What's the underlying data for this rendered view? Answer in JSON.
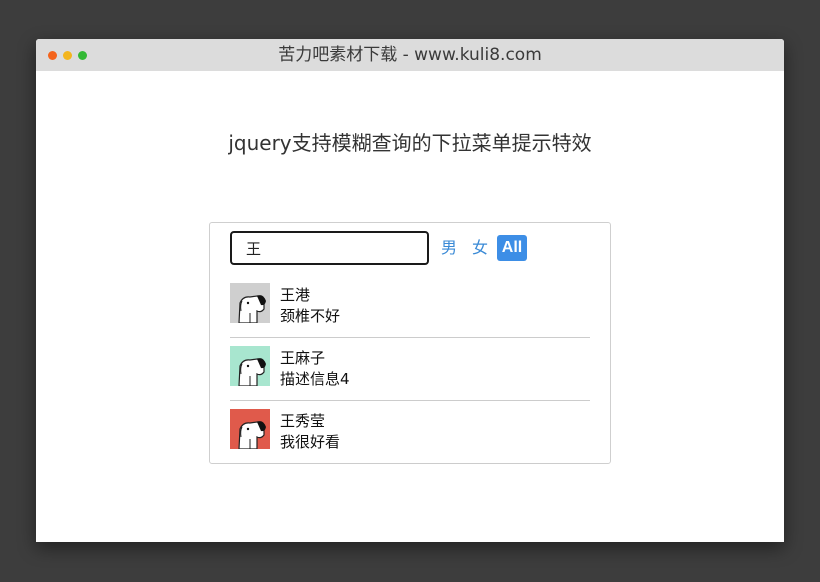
{
  "window": {
    "title": "苦力吧素材下载 - www.kuli8.com"
  },
  "page": {
    "heading": "jquery支持模糊查询的下拉菜单提示特效"
  },
  "search": {
    "value": "王",
    "placeholder": ""
  },
  "filters": {
    "male": "男",
    "female": "女",
    "all": "All",
    "active": "All"
  },
  "results": [
    {
      "name": "王港",
      "description": "颈椎不好",
      "avatar_icon": "dog-avatar-icon",
      "avatar_color": "#cfcfcf"
    },
    {
      "name": "王麻子",
      "description": "描述信息4",
      "avatar_icon": "dog-avatar-icon",
      "avatar_color": "#a8e6cf"
    },
    {
      "name": "王秀莹",
      "description": "我很好看",
      "avatar_icon": "dog-avatar-icon",
      "avatar_color": "#e05a4b"
    }
  ],
  "colors": {
    "accent": "#3d8ee6",
    "filter_link": "#3a8ad6",
    "backdrop": "#3d3d3d"
  }
}
